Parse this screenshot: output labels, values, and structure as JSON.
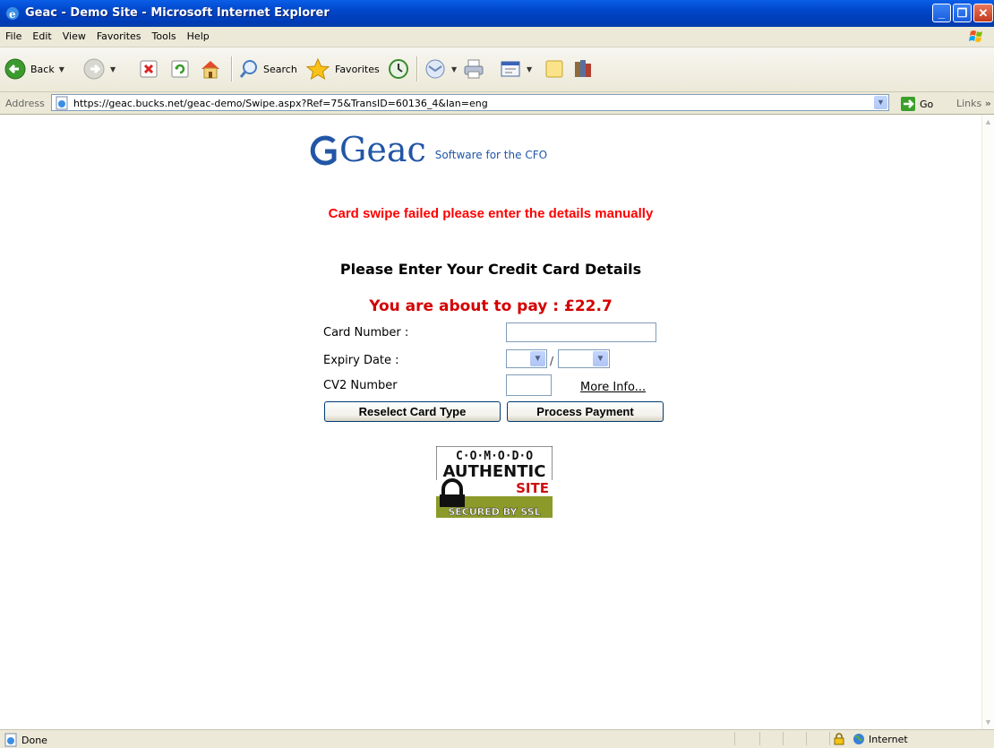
{
  "window": {
    "title": "Geac - Demo Site - Microsoft Internet Explorer"
  },
  "menu": [
    "File",
    "Edit",
    "View",
    "Favorites",
    "Tools",
    "Help"
  ],
  "toolbar": {
    "back": "Back",
    "search": "Search",
    "favorites": "Favorites"
  },
  "address": {
    "label": "Address",
    "url": "https://geac.bucks.net/geac-demo/Swipe.aspx?Ref=75&TransID=60136_4&lan=eng",
    "go": "Go",
    "links": "Links"
  },
  "page": {
    "logo_word": "Geac",
    "logo_tagline": "Software for the CFO",
    "error": "Card swipe failed please enter the details manually",
    "heading": "Please Enter Your Credit Card Details",
    "amount": "You are about to pay : £22.7",
    "card_number_label": "Card Number :",
    "card_number_value": "",
    "expiry_label": "Expiry Date :",
    "expiry_month": "",
    "expiry_year": "",
    "expiry_sep": "/",
    "cv2_label": "CV2 Number",
    "cv2_value": "",
    "more_info": "More Info...",
    "reselect_button": "Reselect Card Type",
    "process_button": "Process Payment",
    "seal": {
      "line1": "C·O·M·O·D·O",
      "line2": "AUTHENTIC",
      "line3": "SITE",
      "line4": "SECURED BY SSL"
    }
  },
  "status": {
    "text": "Done",
    "zone": "Internet"
  },
  "colors": {
    "error": "#ff0000",
    "amount": "#d40000",
    "logo": "#2256a6",
    "titlebar": "#0046c8"
  }
}
